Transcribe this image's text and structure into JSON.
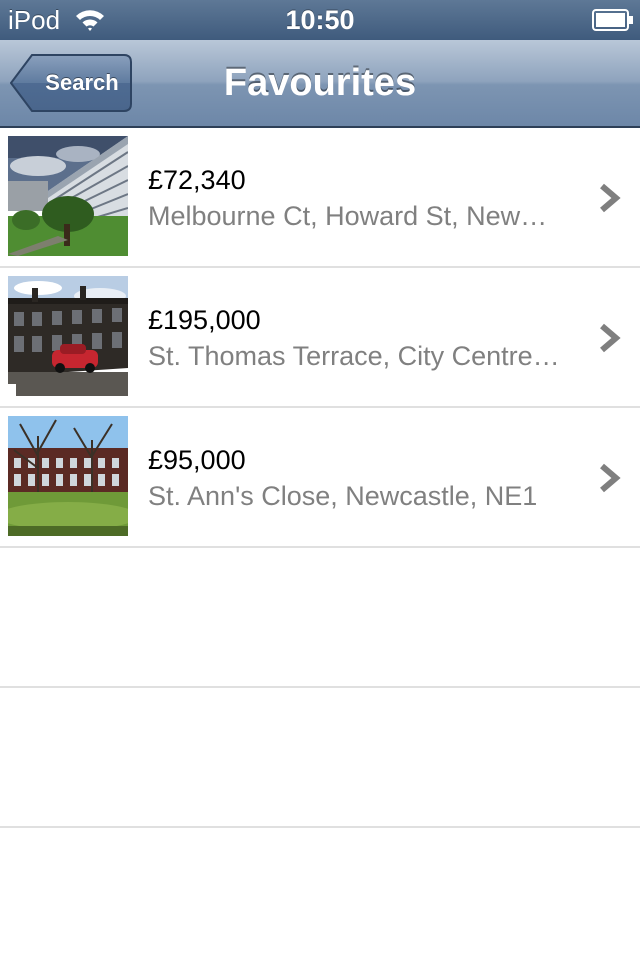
{
  "status_bar": {
    "carrier": "iPod",
    "time": "10:50",
    "wifi_icon": "wifi-icon",
    "battery_icon": "battery-icon"
  },
  "nav_bar": {
    "back_label": "Search",
    "title": "Favourites"
  },
  "favourites": [
    {
      "price": "£72,340",
      "address": "Melbourne Ct, Howard St, New…",
      "thumbnail": "photo of high-rise apartment block with trees"
    },
    {
      "price": "£195,000",
      "address": "St. Thomas Terrace, City Centre…",
      "thumbnail": "photo of stone terraced houses with red car"
    },
    {
      "price": "£95,000",
      "address": "St. Ann's Close, Newcastle, NE1",
      "thumbnail": "photo of brick terrace behind green lawn and bare trees"
    }
  ],
  "icons": {
    "row_disclosure": "chevron-right-icon",
    "back": "back-arrow-button"
  },
  "colors": {
    "nav_bar": "#7d95b2",
    "status_bar": "#4a6586",
    "address_text": "#808080",
    "separator": "#e0e0e0",
    "chevron": "#7f7f7f"
  }
}
